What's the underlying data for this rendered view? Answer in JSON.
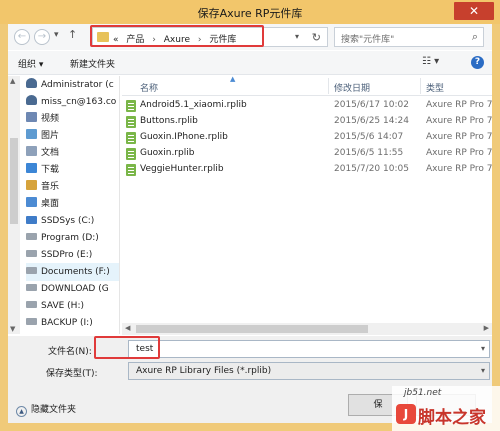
{
  "window": {
    "title": "保存Axure RP元件库",
    "close_glyph": "✕"
  },
  "nav": {
    "back_glyph": "←",
    "forward_glyph": "→",
    "history_glyph": "▾",
    "up_glyph": "↑"
  },
  "address": {
    "overflow": "«",
    "crumbs": [
      "产品",
      "Axure",
      "元件库"
    ],
    "separator": "›",
    "dropdown_glyph": "▾",
    "refresh_glyph": "↻"
  },
  "search": {
    "placeholder": "搜索\"元件库\"",
    "icon_glyph": "⌕"
  },
  "toolbar": {
    "organize": "组织 ▾",
    "new_folder": "新建文件夹",
    "view_glyph": "☷ ▾",
    "help_glyph": "?"
  },
  "sidebar": {
    "items": [
      {
        "label": "Administrator (c",
        "icon": "user-icon"
      },
      {
        "label": "miss_cn@163.co",
        "icon": "user-icon"
      },
      {
        "label": "视频",
        "icon": "video-icon"
      },
      {
        "label": "图片",
        "icon": "picture-icon"
      },
      {
        "label": "文档",
        "icon": "document-icon"
      },
      {
        "label": "下载",
        "icon": "download-icon"
      },
      {
        "label": "音乐",
        "icon": "music-icon"
      },
      {
        "label": "桌面",
        "icon": "desktop-icon"
      },
      {
        "label": "SSDSys (C:)",
        "icon": "system-drive-icon"
      },
      {
        "label": "Program (D:)",
        "icon": "drive-icon"
      },
      {
        "label": "SSDPro (E:)",
        "icon": "drive-icon"
      },
      {
        "label": "Documents (F:)",
        "icon": "drive-icon"
      },
      {
        "label": "DOWNLOAD (G",
        "icon": "drive-icon"
      },
      {
        "label": "SAVE (H:)",
        "icon": "drive-icon"
      },
      {
        "label": "BACKUP (I:)",
        "icon": "drive-icon"
      }
    ],
    "selected_index": 11
  },
  "columns": {
    "name": "名称",
    "modified": "修改日期",
    "type": "类型"
  },
  "files": [
    {
      "name": "Android5.1_xiaomi.rplib",
      "date": "2015/6/17 10:02",
      "type": "Axure RP Pro 7."
    },
    {
      "name": "Buttons.rplib",
      "date": "2015/6/25 14:24",
      "type": "Axure RP Pro 7."
    },
    {
      "name": "Guoxin.IPhone.rplib",
      "date": "2015/5/6 14:07",
      "type": "Axure RP Pro 7."
    },
    {
      "name": "Guoxin.rplib",
      "date": "2015/6/5 11:55",
      "type": "Axure RP Pro 7."
    },
    {
      "name": "VeggieHunter.rplib",
      "date": "2015/7/20 10:05",
      "type": "Axure RP Pro 7."
    }
  ],
  "form": {
    "filename_label": "文件名(N):",
    "filename_value": "test",
    "filetype_label": "保存类型(T):",
    "filetype_value": "Axure RP Library Files (*.rplib)",
    "dropdown_glyph": "▾",
    "hide_folders": "隐藏文件夹",
    "save_label": "保"
  },
  "watermark": {
    "site": "jb51.net",
    "text": "脚本之家",
    "logo_glyph": "J"
  },
  "colors": {
    "title_bar": "#f2c66b",
    "close_button": "#c7402d",
    "highlight": "#e03a3a",
    "file_icon": "#7ab648"
  }
}
